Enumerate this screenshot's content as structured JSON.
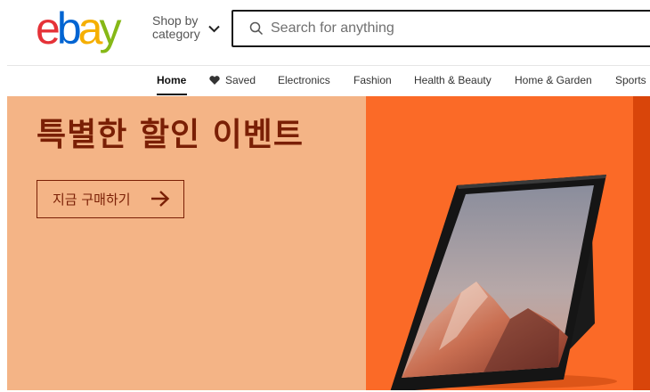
{
  "header": {
    "logo": {
      "letters": [
        {
          "char": "e",
          "color": "#e53238"
        },
        {
          "char": "b",
          "color": "#0064d2"
        },
        {
          "char": "a",
          "color": "#f5af02"
        },
        {
          "char": "y",
          "color": "#86b817"
        }
      ]
    },
    "shop_by_category_line1": "Shop by",
    "shop_by_category_line2": "category",
    "search": {
      "placeholder": "Search for anything",
      "value": ""
    }
  },
  "nav": {
    "items": [
      {
        "label": "Home",
        "active": true
      },
      {
        "label": "Saved",
        "icon": "heart-icon"
      },
      {
        "label": "Electronics"
      },
      {
        "label": "Fashion"
      },
      {
        "label": "Health & Beauty"
      },
      {
        "label": "Home & Garden"
      },
      {
        "label": "Sports"
      }
    ]
  },
  "banner": {
    "title": "특별한 할인 이벤트",
    "cta_label": "지금 구매하기",
    "colors": {
      "left_bg": "#f4b486",
      "right_bg": "#fb6a27",
      "edge_bg": "#d9450a",
      "text": "#7a1f05"
    }
  }
}
